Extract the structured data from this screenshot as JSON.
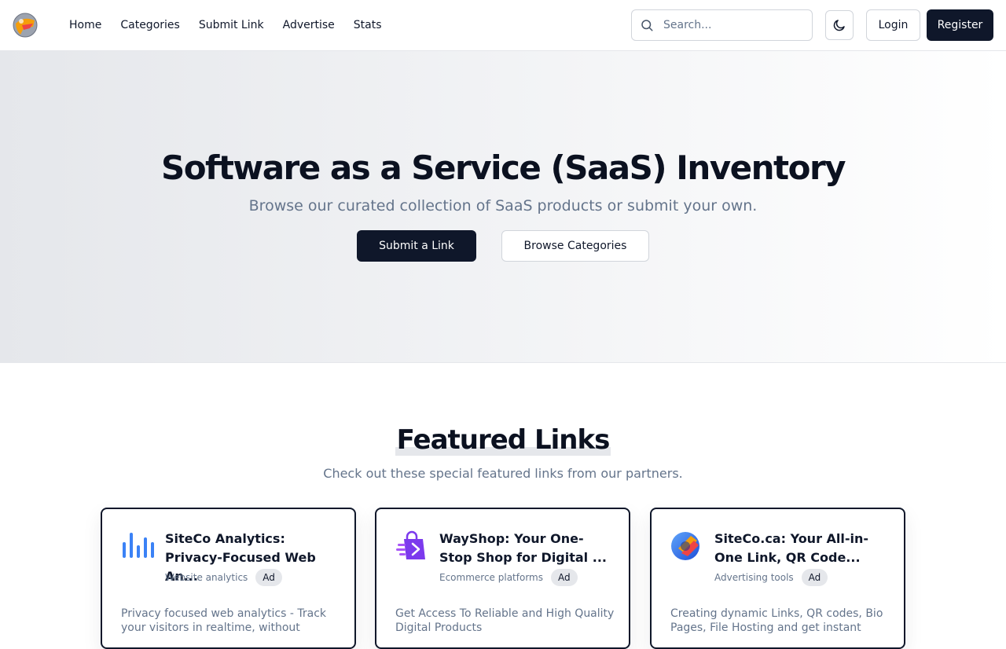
{
  "nav": {
    "links": [
      "Home",
      "Categories",
      "Submit Link",
      "Advertise",
      "Stats"
    ],
    "search_placeholder": "Search...",
    "login_label": "Login",
    "register_label": "Register"
  },
  "hero": {
    "title": "Software as a Service (SaaS) Inventory",
    "subtitle": "Browse our curated collection of SaaS products or submit your own.",
    "primary_button": "Submit a Link",
    "secondary_button": "Browse Categories"
  },
  "featured": {
    "title": "Featured Links",
    "subtitle": "Check out these special featured links from our partners.",
    "cards": [
      {
        "icon": "bar-chart-icon",
        "title": "SiteCo Analytics: Privacy-Focused Web An...",
        "category": "Website analytics",
        "badge": "Ad",
        "description": "Privacy focused web analytics - Track your visitors in realtime, without"
      },
      {
        "icon": "shopping-bag-icon",
        "title": "WayShop: Your One-Stop Shop for Digital ...",
        "category": "Ecommerce platforms",
        "badge": "Ad",
        "description": "Get Access To Reliable and High Quality Digital Products"
      },
      {
        "icon": "link-logo-icon",
        "title": "SiteCo.ca: Your All-in-One Link, QR Code...",
        "category": "Advertising tools",
        "badge": "Ad",
        "description": "Creating dynamic Links, QR codes, Bio Pages, File Hosting and get instant"
      }
    ]
  },
  "colors": {
    "primary": "#0f172a",
    "muted_text": "#64748b",
    "border": "#d1d5db",
    "hero_bg_start": "#e5e7eb",
    "analytics_blue": "#3b82f6",
    "shop_purple": "#7c3aed"
  }
}
